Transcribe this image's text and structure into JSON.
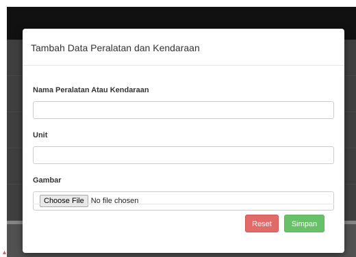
{
  "modal": {
    "title": "Tambah Data Peralatan dan Kendaraan",
    "fields": {
      "name_label": "Nama Peralatan Atau Kendaraan",
      "name_value": "",
      "unit_label": "Unit",
      "unit_value": "",
      "image_label": "Gambar",
      "file_button": "Choose File",
      "file_status": "No file chosen"
    },
    "buttons": {
      "reset": "Reset",
      "save": "Simpan"
    }
  },
  "colors": {
    "reset_button": "#d9534f",
    "save_button": "#5cb85c",
    "topbar": "#222222"
  }
}
